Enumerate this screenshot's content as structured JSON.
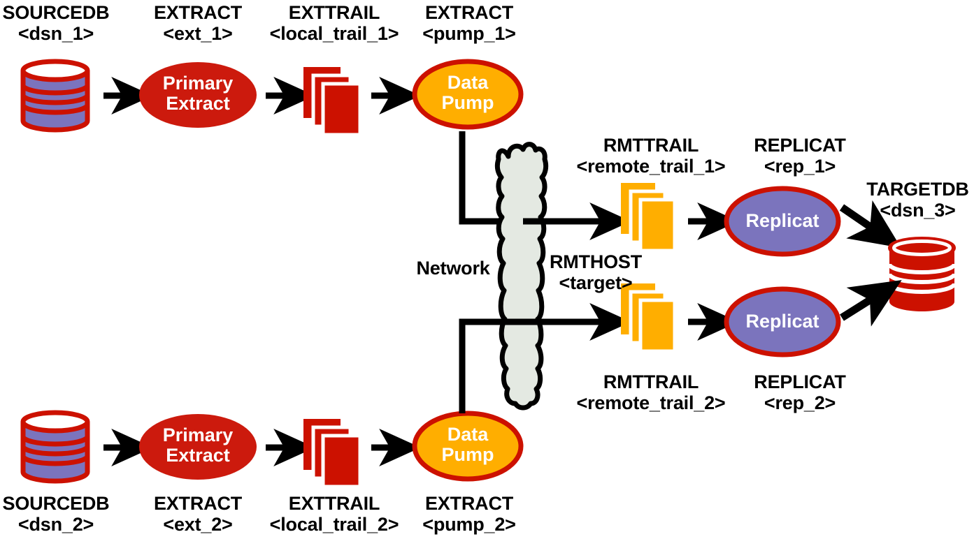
{
  "diagram": {
    "title": "Oracle GoldenGate bidirectional-source replication topology",
    "colors": {
      "dark_red": "#CC1100",
      "extract_red": "#CC1A0D",
      "trail_red": "#CC1100",
      "amber": "#FFAE00",
      "purple": "#7B74BD",
      "cloud_fill": "#E4E9E2",
      "outline_black": "#000000",
      "text_white": "#FFFFFF",
      "text_black": "#000000"
    },
    "labels": {
      "sourcedb_1": {
        "line1": "SOURCEDB",
        "line2": "<dsn_1>"
      },
      "extract_1": {
        "line1": "EXTRACT",
        "line2": "<ext_1>"
      },
      "exttrail_1": {
        "line1": "EXTTRAIL",
        "line2": "<local_trail_1>"
      },
      "pump_extract_1": {
        "line1": "EXTRACT",
        "line2": "<pump_1>"
      },
      "rmttrail_1": {
        "line1": "RMTTRAIL",
        "line2": "<remote_trail_1>"
      },
      "replicat_1": {
        "line1": "REPLICAT",
        "line2": "<rep_1>"
      },
      "targetdb": {
        "line1": "TARGETDB",
        "line2": "<dsn_3>"
      },
      "rmthost": {
        "line1": "RMTHOST",
        "line2": "<target>"
      },
      "network": {
        "line1": "Network"
      },
      "rmttrail_2": {
        "line1": "RMTTRAIL",
        "line2": "<remote_trail_2>"
      },
      "replicat_2": {
        "line1": "REPLICAT",
        "line2": "<rep_2>"
      },
      "sourcedb_2": {
        "line1": "SOURCEDB",
        "line2": "<dsn_2>"
      },
      "extract_2": {
        "line1": "EXTRACT",
        "line2": "<ext_2>"
      },
      "exttrail_2": {
        "line1": "EXTTRAIL",
        "line2": "<local_trail_2>"
      },
      "pump_extract_2": {
        "line1": "EXTRACT",
        "line2": "<pump_2>"
      }
    },
    "nodes": {
      "primary_extract_1": {
        "line1": "Primary",
        "line2": "Extract"
      },
      "data_pump_1": {
        "line1": "Data",
        "line2": "Pump"
      },
      "replicat_node_1": {
        "line1": "Replicat"
      },
      "replicat_node_2": {
        "line1": "Replicat"
      },
      "primary_extract_2": {
        "line1": "Primary",
        "line2": "Extract"
      },
      "data_pump_2": {
        "line1": "Data",
        "line2": "Pump"
      }
    },
    "icons": {
      "source_db_1": "database-cylinder-icon",
      "source_db_2": "database-cylinder-icon",
      "target_db": "database-cylinder-icon",
      "local_trail_1": "trail-files-stack-icon",
      "local_trail_2": "trail-files-stack-icon",
      "remote_trail_1": "trail-files-stack-icon",
      "remote_trail_2": "trail-files-stack-icon",
      "network_cloud": "network-cloud-icon",
      "flow_arrow": "arrow-right-icon"
    }
  }
}
